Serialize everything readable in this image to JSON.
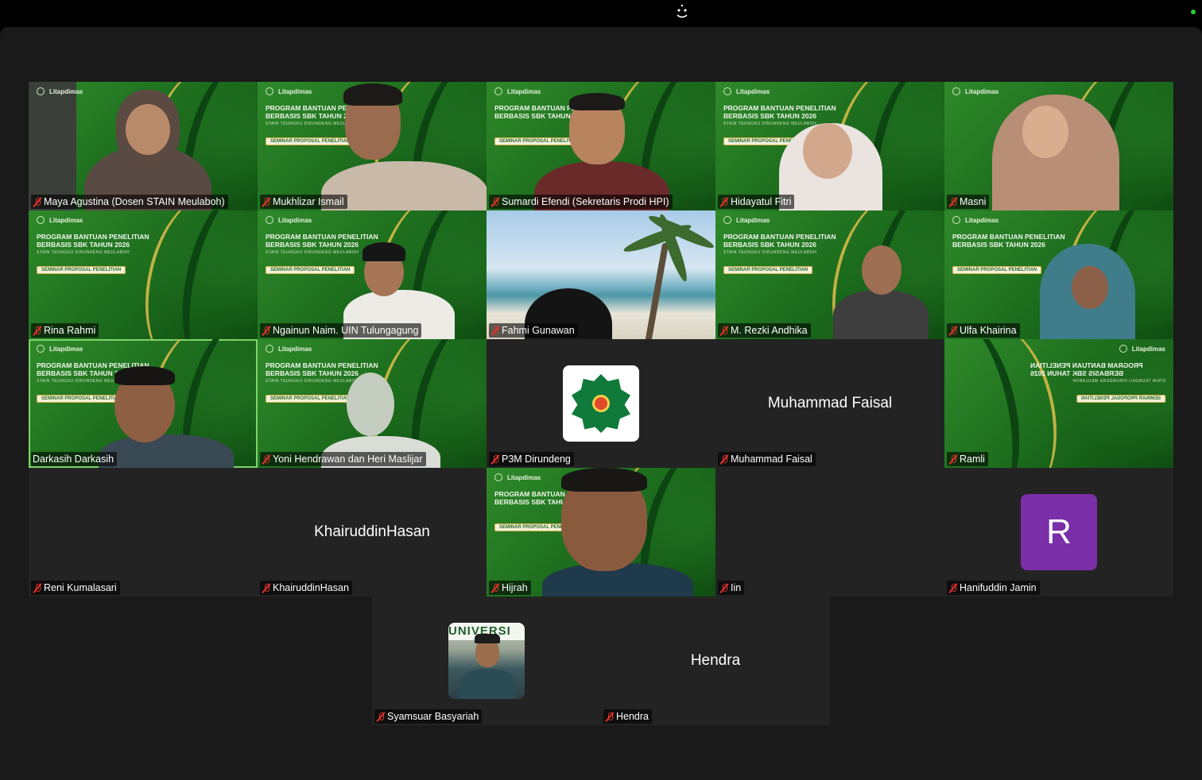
{
  "menubar": {
    "camera_icon": "camera-face-icon"
  },
  "colors": {
    "window_bg": "#1a1a1a",
    "tile_bg": "#232323",
    "active_speaker": "#7ed46a",
    "muted_mic": "#e5332a",
    "avatar_purple": "#7a2ea8"
  },
  "slide": {
    "logo": "Litapdimas",
    "title": "PROGRAM BANTUAN PENELITIAN BERBASIS SBK TAHUN 2026",
    "subtitle": "STAIN TEUNGKU DIRUNDENG MEULABOH",
    "pill": "SEMINAR PROPOSAL PENELITIAN"
  },
  "participants": [
    {
      "name": "Maya Agustina (Dosen STAIN Meulaboh)",
      "muted": true
    },
    {
      "name": "Mukhlizar Ismail",
      "muted": true
    },
    {
      "name": "Sumardi Efendi (Sekretaris Prodi HPI)",
      "muted": true
    },
    {
      "name": "Hidayatul Fitri",
      "muted": true
    },
    {
      "name": "Masni",
      "muted": true
    },
    {
      "name": "Rina Rahmi",
      "muted": true
    },
    {
      "name": "Ngainun Naim. UIN Tulungagung",
      "muted": true
    },
    {
      "name": "Fahmi Gunawan",
      "muted": true
    },
    {
      "name": "M. Rezki Andhika",
      "muted": true
    },
    {
      "name": "Ulfa Khairina",
      "muted": true
    },
    {
      "name": "Darkasih Darkasih",
      "muted": false,
      "active_speaker": true
    },
    {
      "name": "Yoni Hendrawan dan Heri Maslijar",
      "muted": true
    },
    {
      "name": "P3M Dirundeng",
      "muted": true
    },
    {
      "name": "Muhammad Faisal",
      "muted": true,
      "display_name": "Muhammad Faisal"
    },
    {
      "name": "Ramli",
      "muted": true
    },
    {
      "name": "Reni Kumalasari",
      "muted": true
    },
    {
      "name": "KhairuddinHasan",
      "muted": true,
      "display_name": "KhairuddinHasan"
    },
    {
      "name": "Hijrah",
      "muted": true
    },
    {
      "name": "Iin",
      "muted": true
    },
    {
      "name": "Hanifuddin Jamin",
      "muted": true,
      "avatar_letter": "R"
    },
    {
      "name": "Syamsuar Basyariah",
      "muted": true,
      "avatar_banner": "UNIVERSI"
    },
    {
      "name": "Hendra",
      "muted": true,
      "display_name": "Hendra"
    }
  ]
}
